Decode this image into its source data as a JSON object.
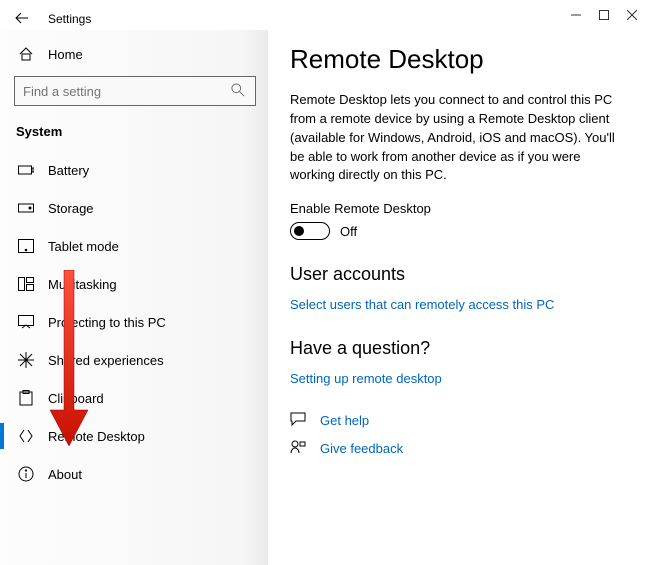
{
  "window": {
    "app_title": "Settings"
  },
  "sidebar": {
    "home_label": "Home",
    "search_placeholder": "Find a setting",
    "section_label": "System",
    "items": [
      {
        "label": "Battery",
        "icon": "battery-icon"
      },
      {
        "label": "Storage",
        "icon": "storage-icon"
      },
      {
        "label": "Tablet mode",
        "icon": "tablet-icon"
      },
      {
        "label": "Multitasking",
        "icon": "multitasking-icon"
      },
      {
        "label": "Projecting to this PC",
        "icon": "projecting-icon"
      },
      {
        "label": "Shared experiences",
        "icon": "shared-icon"
      },
      {
        "label": "Clipboard",
        "icon": "clipboard-icon"
      },
      {
        "label": "Remote Desktop",
        "icon": "remote-desktop-icon"
      },
      {
        "label": "About",
        "icon": "about-icon"
      }
    ]
  },
  "main": {
    "title": "Remote Desktop",
    "description": "Remote Desktop lets you connect to and control this PC from a remote device by using a Remote Desktop client (available for Windows, Android, iOS and macOS). You'll be able to work from another device as if you were working directly on this PC.",
    "toggle_label": "Enable Remote Desktop",
    "toggle_state": "Off",
    "user_accounts_heading": "User accounts",
    "select_users_link": "Select users that can remotely access this PC",
    "question_heading": "Have a question?",
    "setup_link": "Setting up remote desktop",
    "get_help": "Get help",
    "give_feedback": "Give feedback"
  }
}
